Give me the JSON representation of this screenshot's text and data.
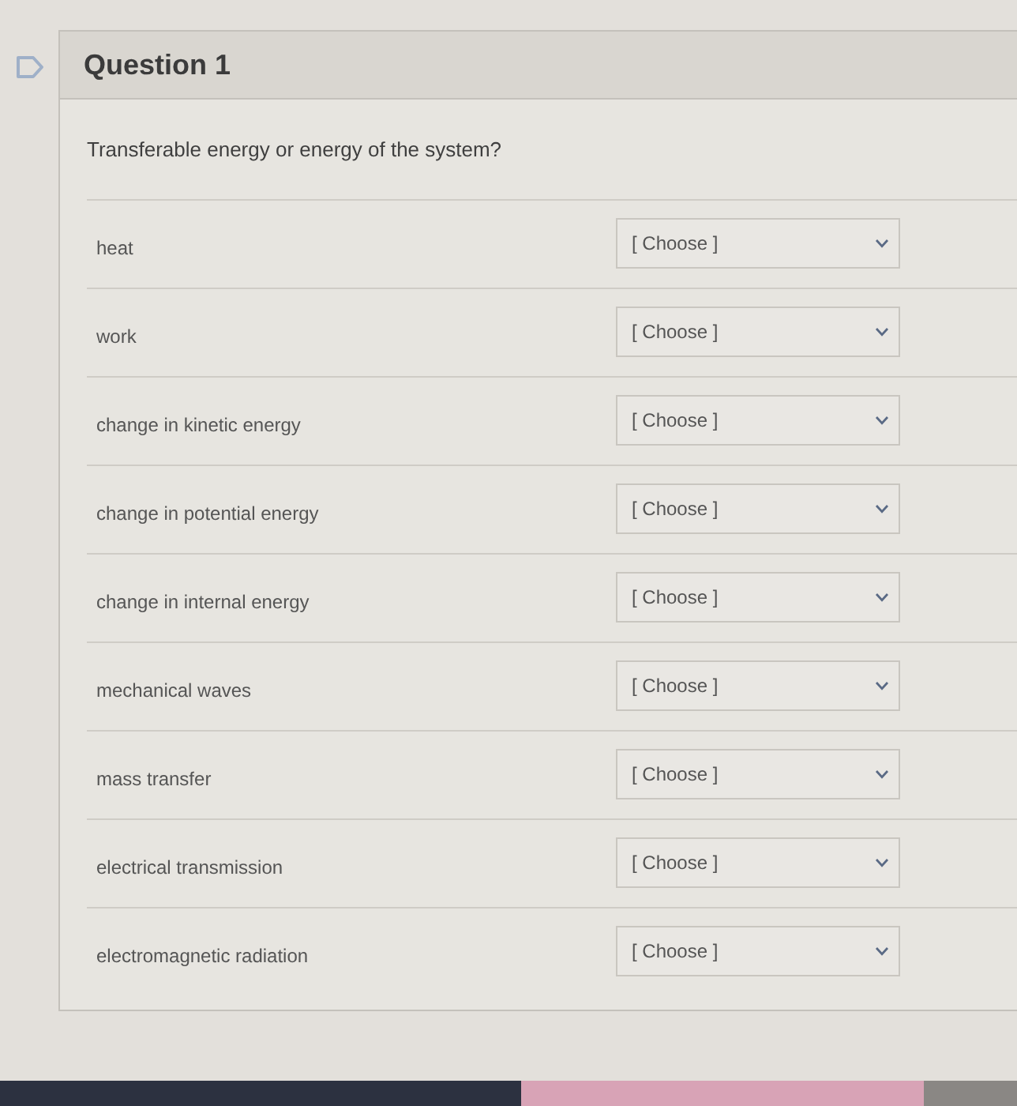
{
  "question": {
    "title": "Question 1",
    "prompt": "Transferable energy or energy of the system?"
  },
  "matches": [
    {
      "label": "heat",
      "answer": "[ Choose ]"
    },
    {
      "label": "work",
      "answer": "[ Choose ]"
    },
    {
      "label": "change in kinetic energy",
      "answer": "[ Choose ]"
    },
    {
      "label": "change in potential energy",
      "answer": "[ Choose ]"
    },
    {
      "label": "change in internal energy",
      "answer": "[ Choose ]"
    },
    {
      "label": "mechanical waves",
      "answer": "[ Choose ]"
    },
    {
      "label": "mass transfer",
      "answer": "[ Choose ]"
    },
    {
      "label": "electrical transmission",
      "answer": "[ Choose ]"
    },
    {
      "label": "electromagnetic radiation",
      "answer": "[ Choose ]"
    }
  ]
}
